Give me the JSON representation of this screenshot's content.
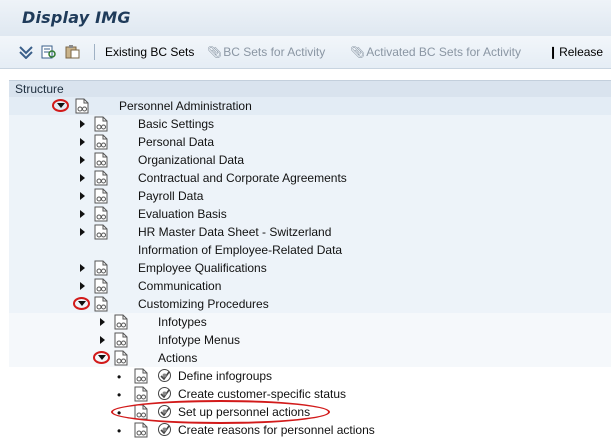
{
  "window": {
    "title": "Display IMG"
  },
  "toolbar": {
    "existing_bc_sets": "Existing BC Sets",
    "bc_sets_for_activity": "BC Sets for Activity",
    "activated_bc_sets": "Activated BC Sets for Activity",
    "release": "Release"
  },
  "structure": {
    "header": "Structure",
    "root": "Personnel Administration",
    "level1": [
      "Basic Settings",
      "Personal Data",
      "Organizational Data",
      "Contractual and Corporate Agreements",
      "Payroll Data",
      "Evaluation Basis",
      "HR Master Data Sheet - Switzerland",
      "Information of Employee-Related Data",
      "Employee Qualifications",
      "Communication",
      "Customizing Procedures"
    ],
    "level2": [
      "Infotypes",
      "Infotype Menus",
      "Actions"
    ],
    "level3": [
      "Define infogroups",
      "Create customer-specific status",
      "Set up personnel actions",
      "Create reasons for personnel actions"
    ]
  },
  "colors": {
    "accent": "#d21a1a",
    "header_bg": "#d9e3ee"
  }
}
